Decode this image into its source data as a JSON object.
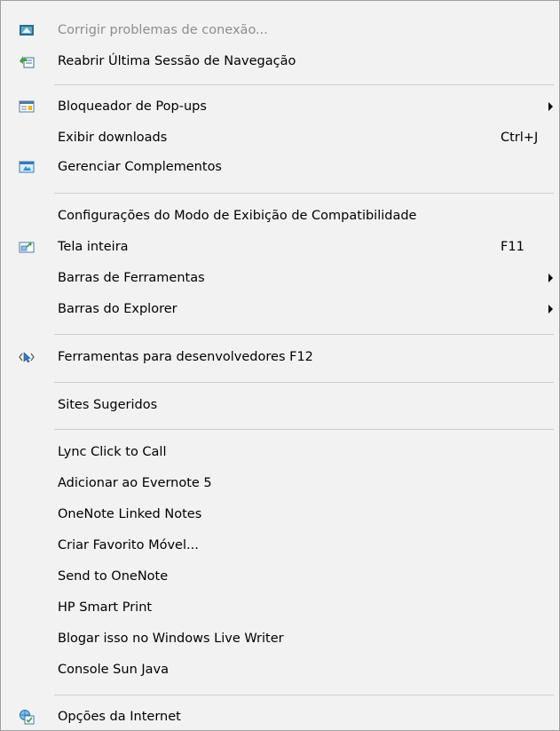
{
  "menu": {
    "items": [
      {
        "label": "Corrigir problemas de conexão...",
        "icon": "network-repair-icon",
        "disabled": true
      },
      {
        "label": "Reabrir Última Sessão de Navegação",
        "icon": "reopen-session-icon"
      },
      {
        "label": "Bloqueador de Pop-ups",
        "icon": "popup-blocker-icon",
        "submenu": true
      },
      {
        "label": "Exibir downloads",
        "shortcut": "Ctrl+J"
      },
      {
        "label": "Gerenciar Complementos",
        "icon": "manage-addons-icon"
      },
      {
        "label": "Configurações do Modo de Exibição de Compatibilidade"
      },
      {
        "label": "Tela inteira",
        "icon": "fullscreen-icon",
        "shortcut": "F11"
      },
      {
        "label": "Barras de Ferramentas",
        "submenu": true
      },
      {
        "label": "Barras do Explorer",
        "submenu": true
      },
      {
        "label": "Ferramentas para desenvolvedores F12",
        "icon": "developer-tools-icon"
      },
      {
        "label": "Sites Sugeridos"
      },
      {
        "label": "Lync Click to Call"
      },
      {
        "label": "Adicionar ao Evernote 5"
      },
      {
        "label": "OneNote Linked Notes"
      },
      {
        "label": "Criar Favorito Móvel..."
      },
      {
        "label": "Send to OneNote"
      },
      {
        "label": "HP Smart Print"
      },
      {
        "label": "Blogar isso no Windows Live Writer"
      },
      {
        "label": "Console Sun Java"
      },
      {
        "label": "Opções da Internet",
        "icon": "internet-options-icon"
      }
    ]
  }
}
